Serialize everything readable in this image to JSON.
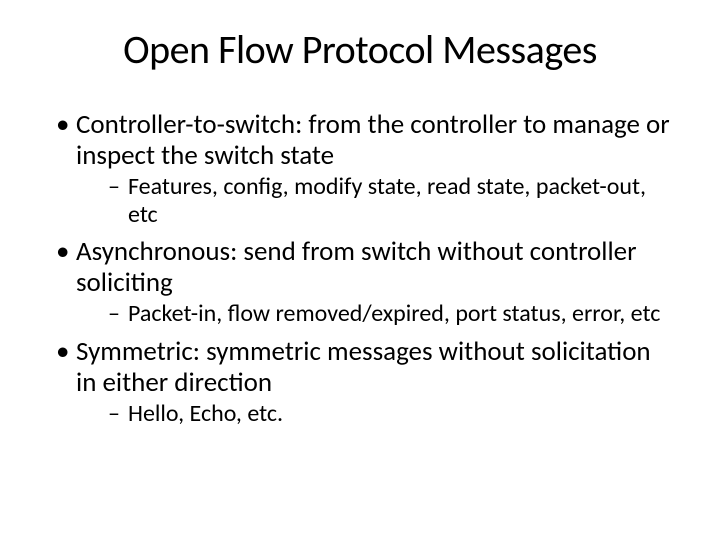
{
  "title": "Open Flow Protocol Messages",
  "bullets": [
    {
      "text": "Controller-to-switch: from the controller to manage or inspect the switch state",
      "sub": "Features, config, modify state, read state, packet-out, etc"
    },
    {
      "text": "Asynchronous: send from switch without controller soliciting",
      "sub": "Packet-in, flow removed/expired, port status, error, etc"
    },
    {
      "text": "Symmetric: symmetric messages without solicitation in either direction",
      "sub": "Hello, Echo, etc."
    }
  ]
}
